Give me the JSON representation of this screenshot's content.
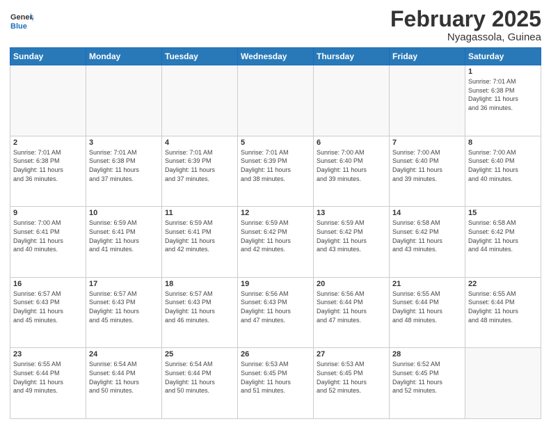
{
  "header": {
    "logo_general": "General",
    "logo_blue": "Blue",
    "month": "February 2025",
    "location": "Nyagassola, Guinea"
  },
  "days_of_week": [
    "Sunday",
    "Monday",
    "Tuesday",
    "Wednesday",
    "Thursday",
    "Friday",
    "Saturday"
  ],
  "weeks": [
    [
      {
        "day": "",
        "info": ""
      },
      {
        "day": "",
        "info": ""
      },
      {
        "day": "",
        "info": ""
      },
      {
        "day": "",
        "info": ""
      },
      {
        "day": "",
        "info": ""
      },
      {
        "day": "",
        "info": ""
      },
      {
        "day": "1",
        "info": "Sunrise: 7:01 AM\nSunset: 6:38 PM\nDaylight: 11 hours\nand 36 minutes."
      }
    ],
    [
      {
        "day": "2",
        "info": "Sunrise: 7:01 AM\nSunset: 6:38 PM\nDaylight: 11 hours\nand 36 minutes."
      },
      {
        "day": "3",
        "info": "Sunrise: 7:01 AM\nSunset: 6:38 PM\nDaylight: 11 hours\nand 37 minutes."
      },
      {
        "day": "4",
        "info": "Sunrise: 7:01 AM\nSunset: 6:39 PM\nDaylight: 11 hours\nand 37 minutes."
      },
      {
        "day": "5",
        "info": "Sunrise: 7:01 AM\nSunset: 6:39 PM\nDaylight: 11 hours\nand 38 minutes."
      },
      {
        "day": "6",
        "info": "Sunrise: 7:00 AM\nSunset: 6:40 PM\nDaylight: 11 hours\nand 39 minutes."
      },
      {
        "day": "7",
        "info": "Sunrise: 7:00 AM\nSunset: 6:40 PM\nDaylight: 11 hours\nand 39 minutes."
      },
      {
        "day": "8",
        "info": "Sunrise: 7:00 AM\nSunset: 6:40 PM\nDaylight: 11 hours\nand 40 minutes."
      }
    ],
    [
      {
        "day": "9",
        "info": "Sunrise: 7:00 AM\nSunset: 6:41 PM\nDaylight: 11 hours\nand 40 minutes."
      },
      {
        "day": "10",
        "info": "Sunrise: 6:59 AM\nSunset: 6:41 PM\nDaylight: 11 hours\nand 41 minutes."
      },
      {
        "day": "11",
        "info": "Sunrise: 6:59 AM\nSunset: 6:41 PM\nDaylight: 11 hours\nand 42 minutes."
      },
      {
        "day": "12",
        "info": "Sunrise: 6:59 AM\nSunset: 6:42 PM\nDaylight: 11 hours\nand 42 minutes."
      },
      {
        "day": "13",
        "info": "Sunrise: 6:59 AM\nSunset: 6:42 PM\nDaylight: 11 hours\nand 43 minutes."
      },
      {
        "day": "14",
        "info": "Sunrise: 6:58 AM\nSunset: 6:42 PM\nDaylight: 11 hours\nand 43 minutes."
      },
      {
        "day": "15",
        "info": "Sunrise: 6:58 AM\nSunset: 6:42 PM\nDaylight: 11 hours\nand 44 minutes."
      }
    ],
    [
      {
        "day": "16",
        "info": "Sunrise: 6:57 AM\nSunset: 6:43 PM\nDaylight: 11 hours\nand 45 minutes."
      },
      {
        "day": "17",
        "info": "Sunrise: 6:57 AM\nSunset: 6:43 PM\nDaylight: 11 hours\nand 45 minutes."
      },
      {
        "day": "18",
        "info": "Sunrise: 6:57 AM\nSunset: 6:43 PM\nDaylight: 11 hours\nand 46 minutes."
      },
      {
        "day": "19",
        "info": "Sunrise: 6:56 AM\nSunset: 6:43 PM\nDaylight: 11 hours\nand 47 minutes."
      },
      {
        "day": "20",
        "info": "Sunrise: 6:56 AM\nSunset: 6:44 PM\nDaylight: 11 hours\nand 47 minutes."
      },
      {
        "day": "21",
        "info": "Sunrise: 6:55 AM\nSunset: 6:44 PM\nDaylight: 11 hours\nand 48 minutes."
      },
      {
        "day": "22",
        "info": "Sunrise: 6:55 AM\nSunset: 6:44 PM\nDaylight: 11 hours\nand 48 minutes."
      }
    ],
    [
      {
        "day": "23",
        "info": "Sunrise: 6:55 AM\nSunset: 6:44 PM\nDaylight: 11 hours\nand 49 minutes."
      },
      {
        "day": "24",
        "info": "Sunrise: 6:54 AM\nSunset: 6:44 PM\nDaylight: 11 hours\nand 50 minutes."
      },
      {
        "day": "25",
        "info": "Sunrise: 6:54 AM\nSunset: 6:44 PM\nDaylight: 11 hours\nand 50 minutes."
      },
      {
        "day": "26",
        "info": "Sunrise: 6:53 AM\nSunset: 6:45 PM\nDaylight: 11 hours\nand 51 minutes."
      },
      {
        "day": "27",
        "info": "Sunrise: 6:53 AM\nSunset: 6:45 PM\nDaylight: 11 hours\nand 52 minutes."
      },
      {
        "day": "28",
        "info": "Sunrise: 6:52 AM\nSunset: 6:45 PM\nDaylight: 11 hours\nand 52 minutes."
      },
      {
        "day": "",
        "info": ""
      }
    ]
  ]
}
